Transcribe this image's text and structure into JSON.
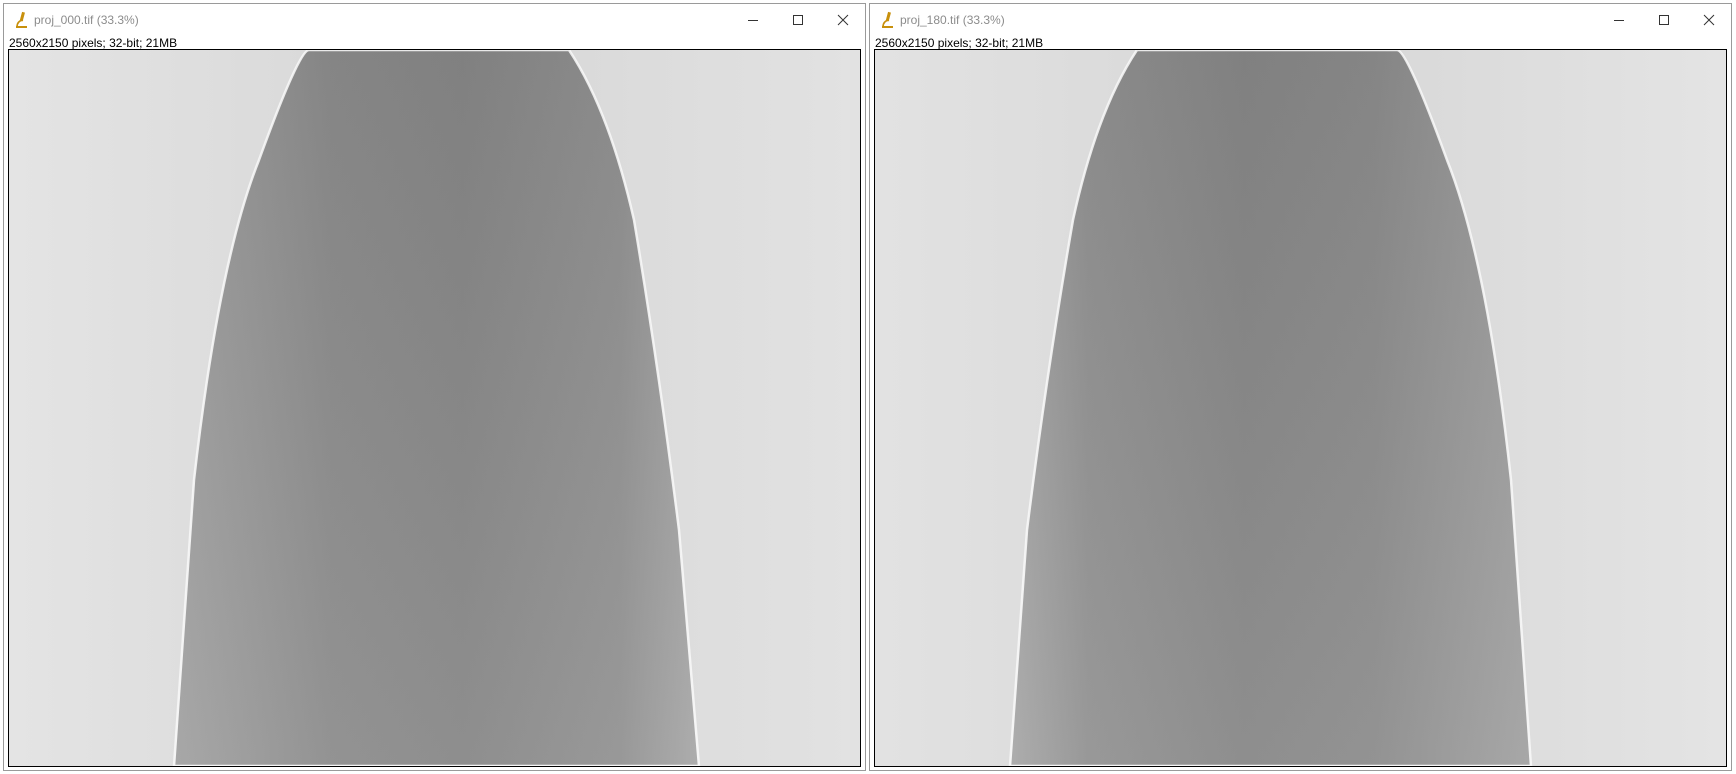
{
  "windows": [
    {
      "title": "proj_000.tif (33.3%)",
      "info": "2560x2150 pixels; 32-bit; 21MB",
      "icon": "microscope-icon",
      "controls": [
        "minimize-icon",
        "maximize-icon",
        "close-icon"
      ]
    },
    {
      "title": "proj_180.tif (33.3%)",
      "info": "2560x2150 pixels; 32-bit; 21MB",
      "icon": "microscope-icon",
      "controls": [
        "minimize-icon",
        "maximize-icon",
        "close-icon"
      ]
    }
  ],
  "colors": {
    "background_grey": "#dcdcdc",
    "object_grey": "#8a8a8a",
    "icon_gold": "#c8900c"
  }
}
